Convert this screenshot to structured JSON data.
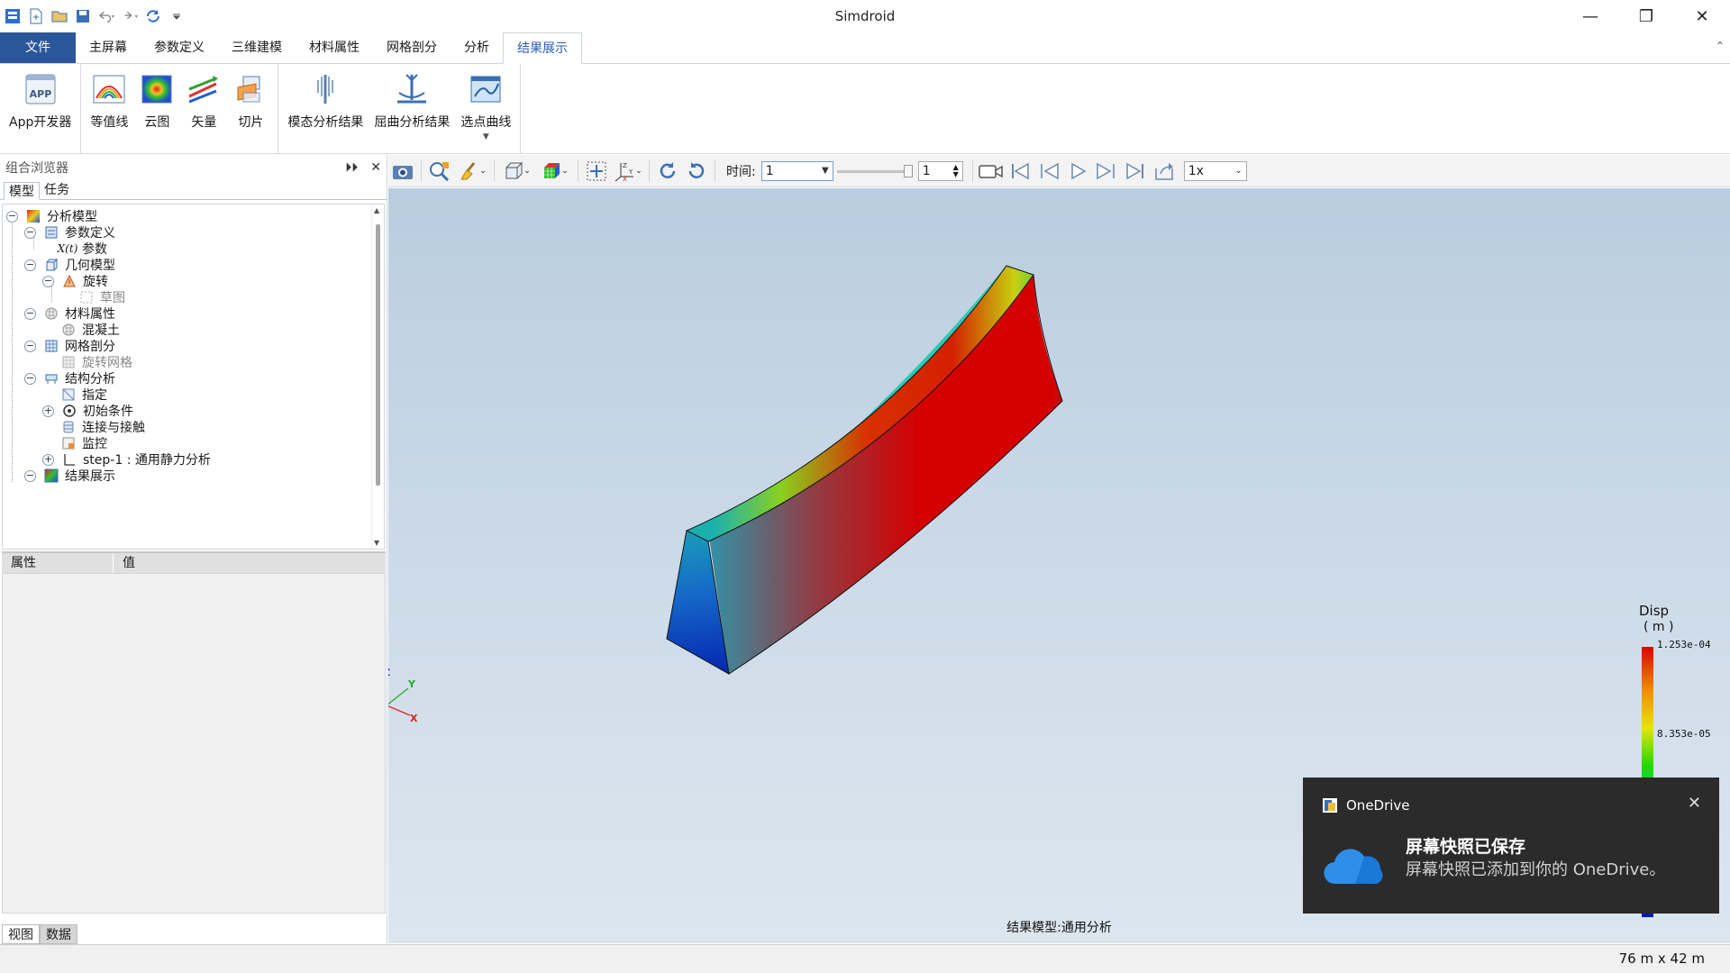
{
  "app": {
    "title": "Simdroid"
  },
  "menu": {
    "file": "文件",
    "tabs": [
      "主屏幕",
      "参数定义",
      "三维建模",
      "材料属性",
      "网格剖分",
      "分析",
      "结果展示"
    ],
    "active_tab": "结果展示"
  },
  "ribbon": {
    "app_dev": "App开发器",
    "contour": "等值线",
    "cloud": "云图",
    "vector": "矢量",
    "slice": "切片",
    "modal_result": "模态分析结果",
    "buckling_result": "屈曲分析结果",
    "point_curve": "选点曲线"
  },
  "browser": {
    "title": "组合浏览器",
    "tab_model": "模型",
    "tab_task": "任务",
    "tree": {
      "analysis_model": "分析模型",
      "param_def": "参数定义",
      "params": "参数",
      "geometry_model": "几何模型",
      "revolve": "旋转",
      "sketch": "草图",
      "material": "材料属性",
      "concrete": "混凝土",
      "meshing": "网格剖分",
      "revolve_mesh": "旋转网格",
      "structural": "结构分析",
      "assign": "指定",
      "initial_cond": "初始条件",
      "contact": "连接与接触",
      "monitor": "监控",
      "step1": "step-1 : 通用静力分析",
      "results": "结果展示"
    }
  },
  "properties": {
    "col_property": "属性",
    "col_value": "值"
  },
  "bottom_tabs": {
    "view": "视图",
    "data": "数据"
  },
  "viewer_toolbar": {
    "time_label": "时间:",
    "time_value": "1",
    "frame_value": "1",
    "speed": "1x"
  },
  "viewport": {
    "caption": "结果模型:通用分析",
    "axis": {
      "z": "Z",
      "y": "Y",
      "x": "X"
    }
  },
  "legend": {
    "title": "Disp",
    "unit": "( m )",
    "max": "1.253e-04",
    "mid": "8.353e-05",
    "bar_colors": [
      "#e30000",
      "#f08c00",
      "#e6e600",
      "#22d900",
      "#00c8a0",
      "#0070e0",
      "#0018b0"
    ]
  },
  "toast": {
    "app": "OneDrive",
    "title": "屏幕快照已保存",
    "message": "屏幕快照已添加到你的 OneDrive。"
  },
  "status": {
    "size": "76 m x 42 m"
  }
}
